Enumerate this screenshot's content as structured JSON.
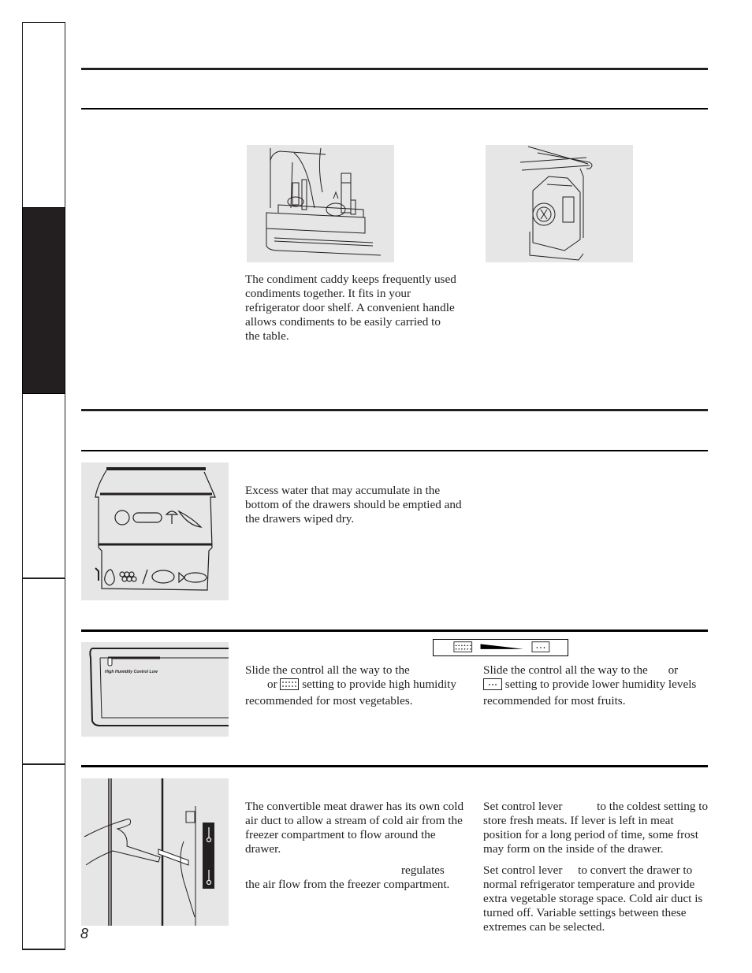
{
  "page": {
    "number": "8"
  },
  "side_tabs": [
    {
      "id": "tab-1",
      "active": false
    },
    {
      "id": "tab-2",
      "active": true
    },
    {
      "id": "tab-3",
      "active": false
    },
    {
      "id": "tab-4",
      "active": false
    },
    {
      "id": "tab-5",
      "active": false
    }
  ],
  "condiment_section": {
    "caddy_figure": "condiment-caddy-illustration",
    "dispenser_figure": "door-bin-dispenser-illustration",
    "caddy_text": "The condiment caddy keeps frequently used condiments together. It fits in your refrigerator door shelf. A convenient handle allows condiments to be easily carried to the table."
  },
  "drawers_section": {
    "figure": "crisper-drawers-illustration",
    "text": "Excess water that may accumulate in the bottom of the drawers should be emptied and the drawers wiped dry."
  },
  "humidity_section": {
    "figure": "humidity-control-panel-illustration",
    "panel_label": "High   Humidity Control   Low",
    "scale": {
      "high_icon": "high-humidity-icon",
      "low_icon": "low-humidity-icon"
    },
    "high_text": {
      "part1": "Slide the control all the way to the",
      "part2": "or",
      "part3": "setting to provide high humidity recommended for most vegetables."
    },
    "low_text": {
      "part1": "Slide the control all the way to the",
      "part2": "or",
      "part3": "setting to provide lower humidity levels recommended for most fruits."
    }
  },
  "meat_drawer_section": {
    "figure": "meat-drawer-control-lever-illustration",
    "text1": "The convertible meat drawer has its own cold air duct to allow a stream of cold air from the freezer compartment to flow around the drawer.",
    "text2_tail": "regulates",
    "text2_rest": "the air flow from the freezer compartment.",
    "cold_setting_part1": "Set control lever",
    "cold_setting_part2": "to the coldest setting to store fresh meats. If lever is left in meat position for a long period of time, some frost may form on the inside of the drawer.",
    "normal_setting_part1": "Set control lever",
    "normal_setting_part2": "to convert the drawer to normal refrigerator temperature and provide extra vegetable storage space. Cold air duct is turned off. Variable settings between these extremes can be selected."
  }
}
